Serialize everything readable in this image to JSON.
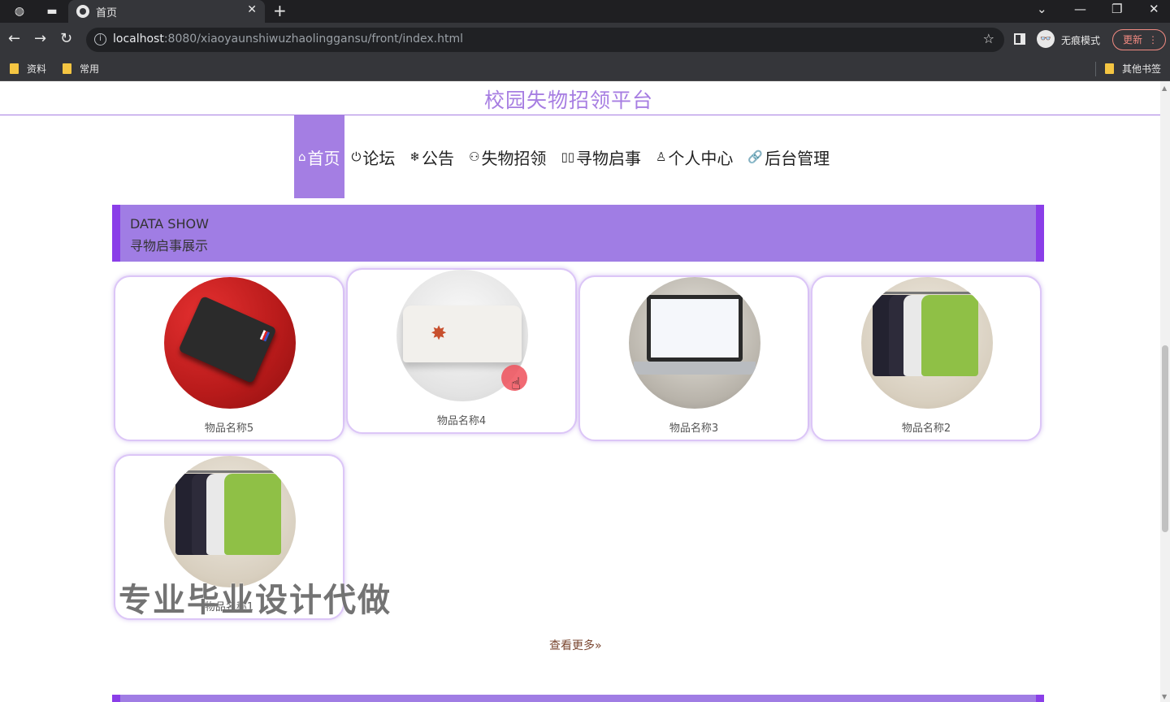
{
  "browser": {
    "tab_title": "首页",
    "new_tab": "+",
    "url_host": "localhost",
    "url_path": ":8080/xiaoyaunshiwuzhaolinggansu/front/index.html",
    "incognito_label": "无痕模式",
    "update_label": "更新",
    "bookmarks": [
      "资料",
      "常用"
    ],
    "other_bookmarks": "其他书签"
  },
  "site": {
    "title": "校园失物招领平台",
    "nav": [
      {
        "icon": "⌂",
        "label": "首页"
      },
      {
        "icon": "⏻",
        "label": "论坛"
      },
      {
        "icon": "❄",
        "label": "公告"
      },
      {
        "icon": "⚇",
        "label": "失物招领"
      },
      {
        "icon": "▯▯",
        "label": "寻物启事"
      },
      {
        "icon": "♙",
        "label": "个人中心"
      },
      {
        "icon": "🔗",
        "label": "后台管理"
      }
    ]
  },
  "section": {
    "en": "DATA SHOW",
    "zh": "寻物启事展示"
  },
  "items": [
    {
      "name": "物品名称5",
      "image": "wallet"
    },
    {
      "name": "物品名称4",
      "image": "book"
    },
    {
      "name": "物品名称3",
      "image": "laptop"
    },
    {
      "name": "物品名称2",
      "image": "shirts"
    },
    {
      "name": "物品名称1",
      "image": "shirts"
    }
  ],
  "more_label": "查看更多»",
  "watermark": "专业毕业设计代做",
  "colors": {
    "accent": "#a47ee3",
    "accent_dark": "#8a3ee8"
  }
}
